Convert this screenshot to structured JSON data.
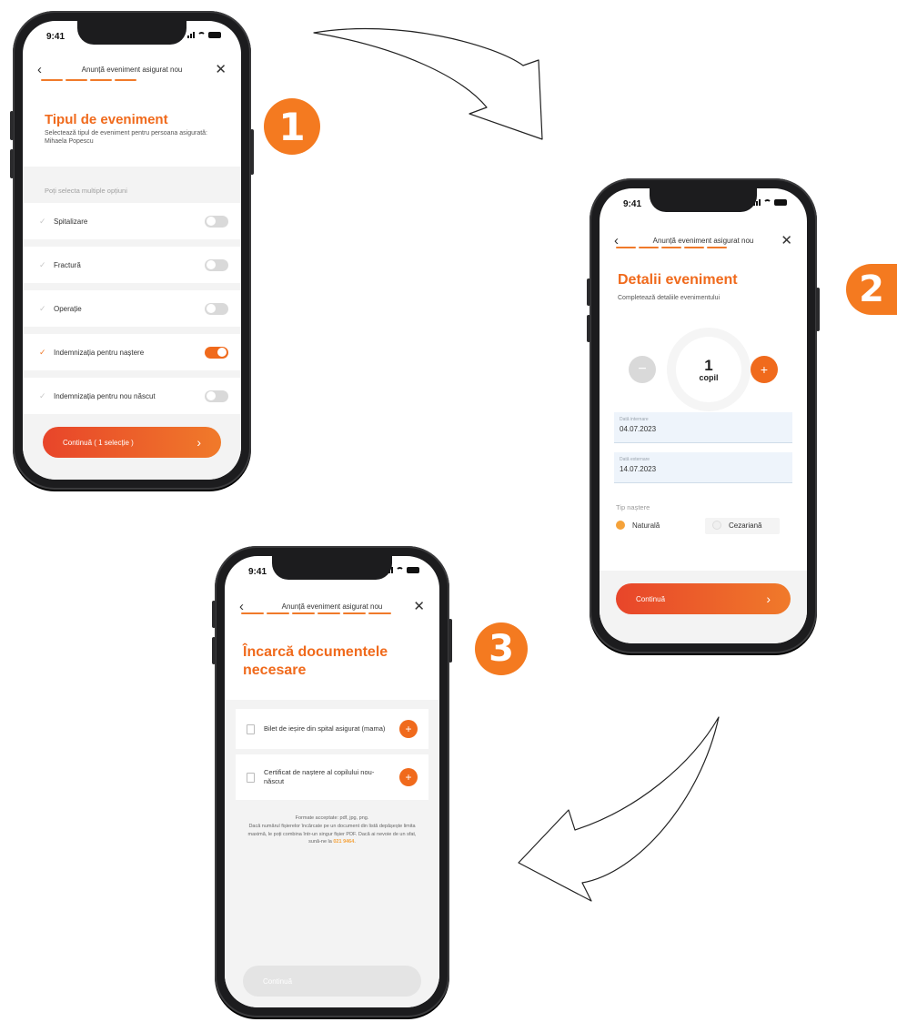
{
  "colors": {
    "accent": "#f06a1c",
    "badge": "#f47a20",
    "gradient_start": "#e8452a",
    "gradient_end": "#f07a2a",
    "field_bg": "#eef4fb"
  },
  "step_badges": [
    "1",
    "2",
    "3"
  ],
  "screen1": {
    "status_time": "9:41",
    "header_title": "Anunță eveniment asigurat nou",
    "title": "Tipul de eveniment",
    "subtitle": "Selectează tipul de eveniment pentru persoana asigurată: Mihaela Popescu",
    "section_hint": "Poți selecta multiple opțiuni",
    "options": [
      {
        "label": "Spitalizare",
        "selected": false
      },
      {
        "label": "Fractură",
        "selected": false
      },
      {
        "label": "Operație",
        "selected": false
      },
      {
        "label": "Indemnizația pentru naștere",
        "selected": true
      },
      {
        "label": "Indemnizația pentru nou născut",
        "selected": false
      }
    ],
    "cta_label": "Continuă ( 1 selecție )",
    "cta_icon": "chevron-right-icon"
  },
  "screen2": {
    "status_time": "9:41",
    "header_title": "Anunță eveniment asigurat nou",
    "title": "Detalii eveniment",
    "subtitle": "Completează detaliile evenimentului",
    "stepper": {
      "value": "1",
      "unit": "copil",
      "minus": "−",
      "plus": "+"
    },
    "admission": {
      "label": "Dată internare",
      "value": "04.07.2023"
    },
    "discharge": {
      "label": "Dată externare",
      "value": "14.07.2023"
    },
    "birth_type_label": "Tip naștere",
    "birth_options": [
      {
        "label": "Naturală",
        "selected": true
      },
      {
        "label": "Cezariană",
        "selected": false
      }
    ],
    "cta_label": "Continuă"
  },
  "screen3": {
    "status_time": "9:41",
    "header_title": "Anunță eveniment asigurat nou",
    "title": "Încarcă documentele necesare",
    "documents": [
      {
        "label": "Bilet de ieșire din spital asigurat (mama)"
      },
      {
        "label": "Certificat de naștere al copilului nou-născut"
      }
    ],
    "footnote_formats": "Formate acceptate: pdf, jpg, png.",
    "footnote_body": "Dacă numărul fișierelor încărcate pe un document din listă depășește limita maximă, le poți combina într-un singur fișier PDF. Dacă ai nevoie de un sfat, sună-ne la",
    "footnote_phone": "021 9464",
    "cta_label": "Continuă"
  }
}
